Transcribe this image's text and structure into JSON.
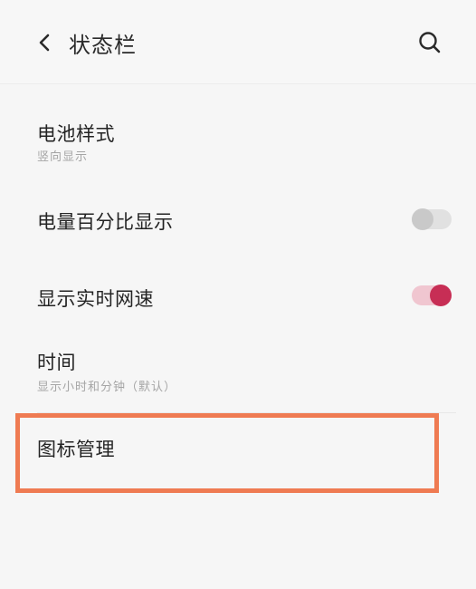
{
  "header": {
    "title": "状态栏",
    "back_icon": "chevron-left-icon",
    "search_icon": "search-icon"
  },
  "settings": {
    "battery_style": {
      "title": "电池样式",
      "subtitle": "竖向显示"
    },
    "battery_percent": {
      "title": "电量百分比显示",
      "toggle_on": false
    },
    "realtime_speed": {
      "title": "显示实时网速",
      "toggle_on": true
    },
    "time": {
      "title": "时间",
      "subtitle": "显示小时和分钟（默认）"
    },
    "icon_management": {
      "title": "图标管理"
    }
  },
  "colors": {
    "toggle_on_knob": "#c72e55",
    "toggle_on_track": "#f0c6d0",
    "toggle_off_knob": "#c9c9c9",
    "toggle_off_track": "#e1e1e1",
    "highlight_border": "#ef7b52"
  }
}
